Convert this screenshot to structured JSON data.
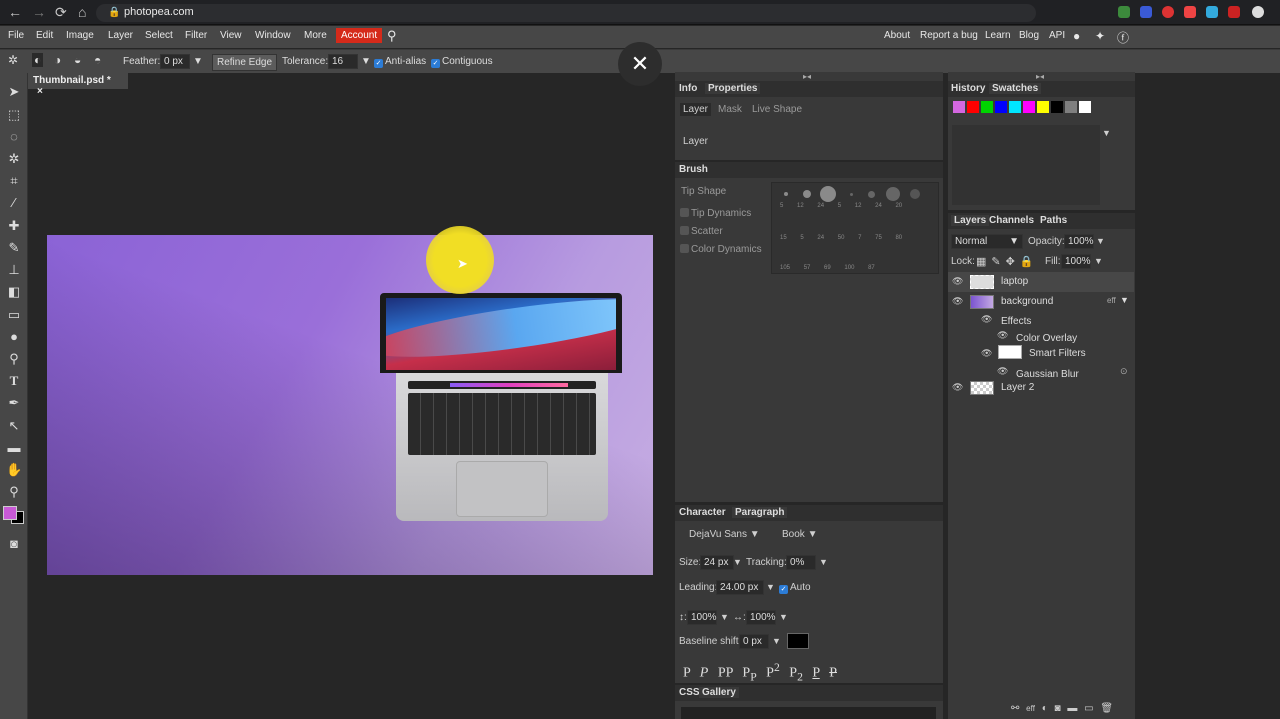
{
  "browser": {
    "url": "photopea.com"
  },
  "menu": {
    "file": "File",
    "edit": "Edit",
    "image": "Image",
    "layer": "Layer",
    "select": "Select",
    "filter": "Filter",
    "view": "View",
    "window": "Window",
    "more": "More",
    "account": "Account",
    "about": "About",
    "report": "Report a bug",
    "learn": "Learn",
    "blog": "Blog",
    "api": "API"
  },
  "options": {
    "feather_label": "Feather:",
    "feather_value": "0",
    "feather_unit": "px",
    "refine": "Refine Edge",
    "tolerance_label": "Tolerance:",
    "tolerance_value": "16",
    "antialias": "Anti-alias",
    "contiguous": "Contiguous"
  },
  "doc": {
    "tab": "Thumbnail.psd *",
    "close": "×"
  },
  "info_panel": {
    "tabs": [
      "Info",
      "Properties"
    ],
    "subtabs": [
      "Layer",
      "Mask",
      "Live Shape"
    ],
    "content": "Layer"
  },
  "brush_panel": {
    "tab": "Brush",
    "items": [
      "Tip Shape",
      "Tip Dynamics",
      "Scatter",
      "Color Dynamics"
    ],
    "sizes": [
      "5",
      "12",
      "24",
      "5",
      "12",
      "24",
      "20",
      "15",
      "5",
      "24",
      "50",
      "7",
      "75",
      "80",
      "105",
      "57",
      "69",
      "100",
      "87"
    ]
  },
  "char_panel": {
    "tabs": [
      "Character",
      "Paragraph"
    ],
    "font": "DejaVu Sans",
    "weight": "Book",
    "size_label": "Size:",
    "size": "24 px",
    "tracking_label": "Tracking:",
    "tracking": "0%",
    "leading_label": "Leading:",
    "leading": "24.00 px",
    "auto": "Auto",
    "vscale_label": "↕:",
    "vscale": "100%",
    "hscale_label": "↔:",
    "hscale": "100%",
    "baseline_label": "Baseline shift:",
    "baseline": "0 px"
  },
  "css_panel": {
    "tabs": [
      "CSS",
      "Gallery"
    ]
  },
  "history_panel": {
    "tabs": [
      "History",
      "Swatches"
    ]
  },
  "swatches": [
    "#d467e0",
    "#ff0000",
    "#00d400",
    "#0000ff",
    "#00e6ff",
    "#ff00ff",
    "#ffff00",
    "#000000",
    "#7f7f7f",
    "#ffffff"
  ],
  "layers_panel": {
    "tabs": [
      "Layers",
      "Channels",
      "Paths"
    ],
    "blend": "Normal",
    "opacity_label": "Opacity:",
    "opacity": "100%",
    "lock_label": "Lock:",
    "fill_label": "Fill:",
    "fill": "100%",
    "layers": [
      {
        "name": "laptop"
      },
      {
        "name": "background"
      },
      {
        "name": "Effects"
      },
      {
        "name": "Color Overlay"
      },
      {
        "name": "Smart Filters"
      },
      {
        "name": "Gaussian Blur"
      },
      {
        "name": "Layer 2"
      }
    ],
    "eff": "eff",
    "footer_eff": "eff"
  },
  "colors": {
    "fg": "#c85ad6",
    "bg": "#000000",
    "accent": "#2c7cd6",
    "account": "#d52a1a"
  }
}
